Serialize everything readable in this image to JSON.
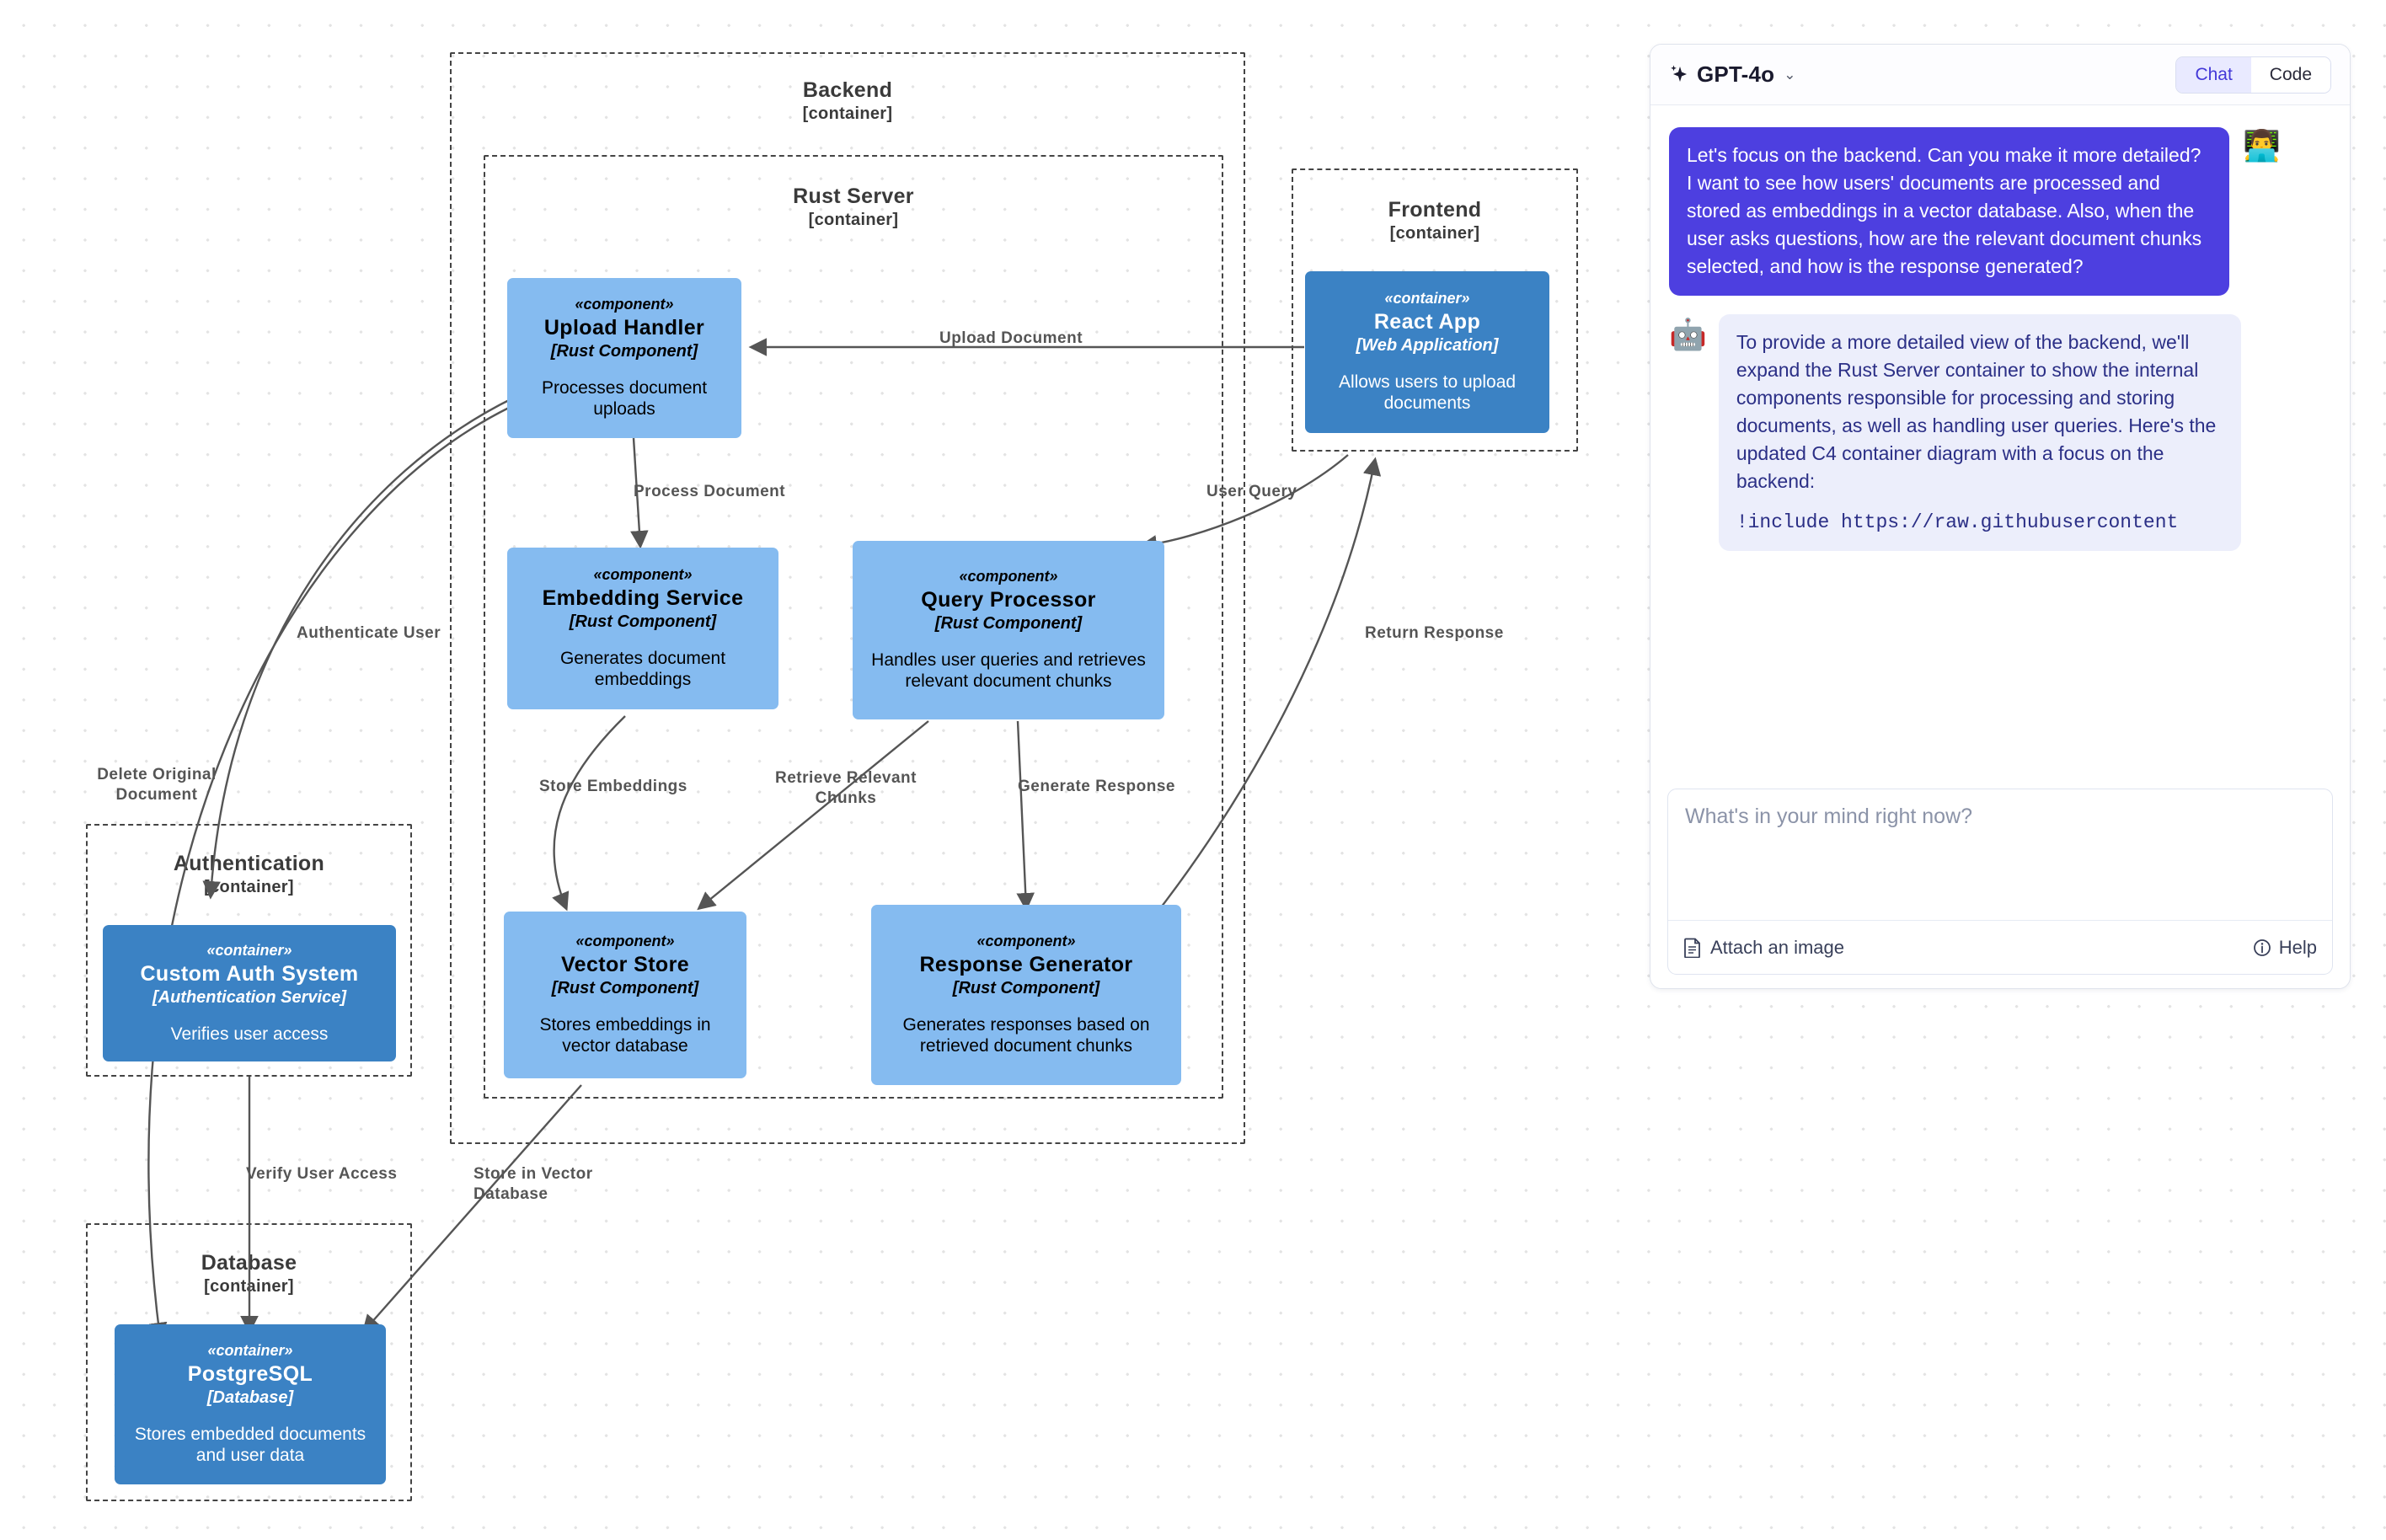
{
  "diagram": {
    "boundaries": [
      {
        "id": "backend",
        "name": "Backend",
        "type": "[container]"
      },
      {
        "id": "rustserver",
        "name": "Rust Server",
        "type": "[container]"
      },
      {
        "id": "frontend",
        "name": "Frontend",
        "type": "[container]"
      },
      {
        "id": "auth",
        "name": "Authentication",
        "type": "[container]"
      },
      {
        "id": "database",
        "name": "Database",
        "type": "[container]"
      }
    ],
    "nodes": [
      {
        "id": "upload",
        "stereo": "«component»",
        "name": "Upload Handler",
        "tech": "[Rust Component]",
        "desc": "Processes document uploads",
        "kind": "component"
      },
      {
        "id": "embed",
        "stereo": "«component»",
        "name": "Embedding Service",
        "tech": "[Rust Component]",
        "desc": "Generates document embeddings",
        "kind": "component"
      },
      {
        "id": "query",
        "stereo": "«component»",
        "name": "Query Processor",
        "tech": "[Rust Component]",
        "desc": "Handles user queries and retrieves relevant document chunks",
        "kind": "component"
      },
      {
        "id": "vector",
        "stereo": "«component»",
        "name": "Vector Store",
        "tech": "[Rust Component]",
        "desc": "Stores embeddings in vector database",
        "kind": "component"
      },
      {
        "id": "respgen",
        "stereo": "«component»",
        "name": "Response Generator",
        "tech": "[Rust Component]",
        "desc": "Generates responses based on retrieved document chunks",
        "kind": "component"
      },
      {
        "id": "react",
        "stereo": "«container»",
        "name": "React App",
        "tech": "[Web Application]",
        "desc": "Allows users to upload documents",
        "kind": "container"
      },
      {
        "id": "customauth",
        "stereo": "«container»",
        "name": "Custom Auth System",
        "tech": "[Authentication Service]",
        "desc": "Verifies user access",
        "kind": "container"
      },
      {
        "id": "postgres",
        "stereo": "«container»",
        "name": "PostgreSQL",
        "tech": "[Database]",
        "desc": "Stores embedded documents and user data",
        "kind": "container"
      }
    ],
    "edge_labels": [
      {
        "id": "upload-document",
        "text": "Upload Document"
      },
      {
        "id": "authenticate-user",
        "text": "Authenticate User"
      },
      {
        "id": "process-document",
        "text": "Process Document"
      },
      {
        "id": "user-query",
        "text": "User Query"
      },
      {
        "id": "return-response",
        "text": "Return Response"
      },
      {
        "id": "delete-original-doc",
        "text": "Delete Original\nDocument"
      },
      {
        "id": "store-embeddings",
        "text": "Store Embeddings"
      },
      {
        "id": "retrieve-chunks",
        "text": "Retrieve Relevant\nChunks"
      },
      {
        "id": "generate-response",
        "text": "Generate Response"
      },
      {
        "id": "verify-user-access",
        "text": "Verify User Access"
      },
      {
        "id": "store-in-vector-db",
        "text": "Store in Vector\nDatabase"
      }
    ],
    "colors": {
      "component_fill": "#85bbf0",
      "container_fill": "#3b82c4",
      "boundary_stroke": "#444444",
      "edge_stroke": "#555555"
    }
  },
  "chat": {
    "model": "GPT-4o",
    "chevron": "⌄",
    "tabs": [
      {
        "id": "chat",
        "label": "Chat",
        "active": true
      },
      {
        "id": "code",
        "label": "Code",
        "active": false
      }
    ],
    "messages": [
      {
        "role": "user",
        "avatar": "👨‍💻",
        "text": "Let's focus on the backend. Can you make it more detailed? I want to see how users' documents are processed and stored as embeddings in a vector database. Also, when the user asks questions, how are the relevant document chunks selected, and how is the response generated?"
      },
      {
        "role": "assistant",
        "avatar": "🤖",
        "text": "To provide a more detailed view of the backend, we'll expand the Rust Server container to show the internal components responsible for processing and storing documents, as well as handling user queries. Here's the updated C4 container diagram with a focus on the backend:",
        "code": "!include https://raw.githubusercontent"
      }
    ],
    "composer": {
      "placeholder": "What's in your mind right now?",
      "value": "",
      "attach_label": "Attach an image",
      "help_label": "Help"
    }
  }
}
